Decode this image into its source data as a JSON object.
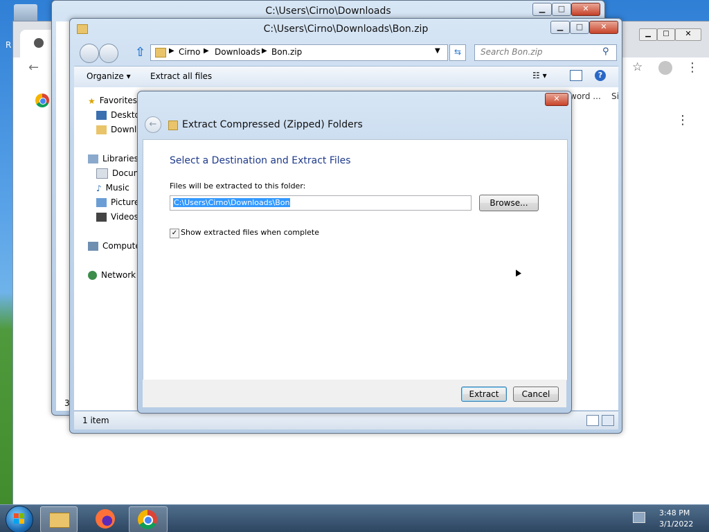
{
  "desktop": {
    "recycle_label": "R"
  },
  "chrome": {
    "tab_label": "3"
  },
  "window_back": {
    "title": "C:\\Users\\Cirno\\Downloads"
  },
  "window_front": {
    "title": "C:\\Users\\Cirno\\Downloads\\Bon.zip",
    "address": {
      "parts": [
        "Cirno",
        "Downloads",
        "Bon.zip"
      ]
    },
    "search_placeholder": "Search Bon.zip",
    "toolbar": {
      "organize": "Organize",
      "extract_all": "Extract all files"
    },
    "nav": {
      "favorites": "Favorites",
      "desktop": "Desktop",
      "downloads": "Downloads",
      "libraries": "Libraries",
      "documents": "Documents",
      "music": "Music",
      "pictures": "Pictures",
      "videos": "Videos",
      "computer": "Computer",
      "network": "Network"
    },
    "col_headers": {
      "password": "word ...",
      "size": "Si"
    },
    "status": "1 item"
  },
  "dialog": {
    "title": "Extract Compressed (Zipped) Folders",
    "heading": "Select a Destination and Extract Files",
    "dest_label": "Files will be extracted to this folder:",
    "dest_value": "C:\\Users\\Cirno\\Downloads\\Bon",
    "browse": "Browse...",
    "checkbox_label": "Show extracted files when complete",
    "checkbox_checked": true,
    "extract": "Extract",
    "cancel": "Cancel"
  },
  "taskbar": {
    "time": "3:48 PM",
    "date": "3/1/2022"
  }
}
